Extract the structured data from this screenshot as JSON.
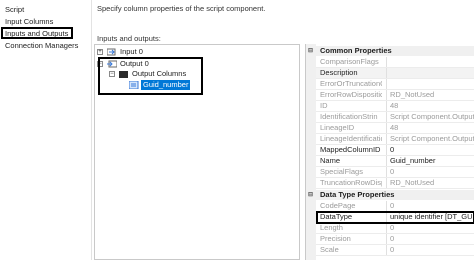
{
  "nav": {
    "items": [
      "Script",
      "Input Columns",
      "Inputs and Outputs",
      "Connection Managers"
    ],
    "selected": "Inputs and Outputs"
  },
  "header": {
    "description": "Specify column properties of the script component."
  },
  "io": {
    "label": "Inputs and outputs:",
    "input": "Input 0",
    "output": "Output 0",
    "output_columns": "Output Columns",
    "column": "Guid_number"
  },
  "props": {
    "common_title": "Common Properties",
    "common": [
      {
        "name": "ComparisonFlags",
        "value": "",
        "dim": true
      },
      {
        "name": "Description",
        "value": "",
        "dim": false
      },
      {
        "name": "ErrorOrTruncationO",
        "value": "",
        "dim": true
      },
      {
        "name": "ErrorRowDispositic",
        "value": "RD_NotUsed",
        "dim": true
      },
      {
        "name": "ID",
        "value": "48",
        "dim": true
      },
      {
        "name": "IdentificationStrin",
        "value": "Script Component.Outputs",
        "dim": true
      },
      {
        "name": "LineageID",
        "value": "48",
        "dim": true
      },
      {
        "name": "LineageIdentificatio",
        "value": "Script Component.Outputs",
        "dim": true
      },
      {
        "name": "MappedColumnID",
        "value": "0",
        "dim": false
      },
      {
        "name": "Name",
        "value": "Guid_number",
        "dim": false
      },
      {
        "name": "SpecialFlags",
        "value": "0",
        "dim": true
      },
      {
        "name": "TruncationRowDisp",
        "value": "RD_NotUsed",
        "dim": true
      }
    ],
    "datatype_title": "Data Type Properties",
    "datatype": [
      {
        "name": "CodePage",
        "value": "0",
        "dim": true
      },
      {
        "name": "DataType",
        "value": "unique identifier [DT_GUID]",
        "dim": false
      },
      {
        "name": "Length",
        "value": "0",
        "dim": true
      },
      {
        "name": "Precision",
        "value": "0",
        "dim": true
      },
      {
        "name": "Scale",
        "value": "0",
        "dim": true
      }
    ]
  }
}
